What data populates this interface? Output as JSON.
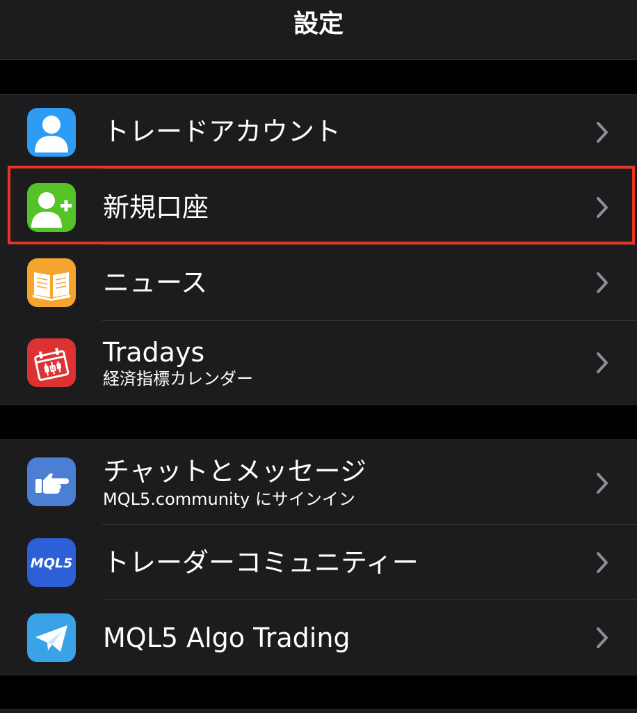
{
  "header": {
    "title": "設定"
  },
  "groups": [
    {
      "items": [
        {
          "label": "トレードアカウント",
          "icon": "person-icon",
          "icon_color": "#2e9cf5"
        },
        {
          "label": "新規口座",
          "icon": "add-person-icon",
          "icon_color": "#55c227",
          "highlighted": true
        },
        {
          "label": "ニュース",
          "icon": "book-icon",
          "icon_color": "#f5a42e"
        },
        {
          "label": "Tradays",
          "sublabel": "経済指標カレンダー",
          "icon": "calendar-icon",
          "icon_color": "#dc3232"
        }
      ]
    },
    {
      "items": [
        {
          "label": "チャットとメッセージ",
          "sublabel": "MQL5.community にサインイン",
          "icon": "pointing-hand-icon",
          "icon_color": "#4a7fd4"
        },
        {
          "label": "トレーダーコミュニティー",
          "icon": "mql5-logo-icon",
          "icon_color": "#2d5fd6",
          "icon_text": "MQL5"
        },
        {
          "label": "MQL5 Algo Trading",
          "icon": "paper-plane-icon",
          "icon_color": "#3aa3e8"
        }
      ]
    }
  ],
  "colors": {
    "background": "#000000",
    "cell": "#1c1c1e",
    "separator": "#38383a",
    "highlight": "#ea3323",
    "chevron": "#8e8e93"
  }
}
